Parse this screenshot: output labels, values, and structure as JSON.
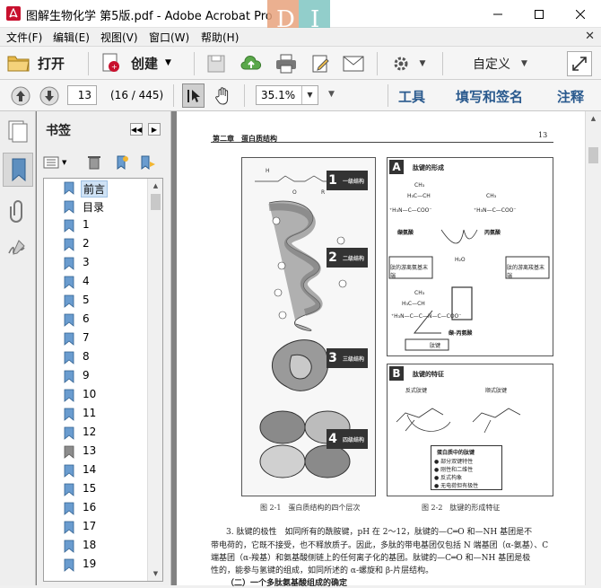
{
  "window": {
    "title": "图解生物化学 第5版.pdf - Adobe Acrobat Pro"
  },
  "menu": {
    "items": [
      "文件(F)",
      "编辑(E)",
      "视图(V)",
      "窗口(W)",
      "帮助(H)"
    ]
  },
  "toolbar": {
    "open_label": "打开",
    "create_label": "创建",
    "customize_label": "自定义"
  },
  "nav": {
    "page_value": "13",
    "page_count": "(16 / 445)",
    "zoom_value": "35.1%",
    "tools_label": "工具",
    "fill_sign_label": "填写和签名",
    "comment_label": "注释"
  },
  "bookmarks": {
    "title": "书签",
    "items": [
      "前言",
      "目录",
      "1",
      "2",
      "3",
      "4",
      "5",
      "6",
      "7",
      "8",
      "9",
      "10",
      "11",
      "12",
      "13",
      "14",
      "15",
      "16",
      "17",
      "18",
      "19"
    ],
    "selected": "前言"
  },
  "document": {
    "header_left": "第二章　蛋白质结构",
    "header_right": "13",
    "fig1_labels": [
      "一级结构",
      "二级结构",
      "三级结构",
      "四级结构"
    ],
    "fig1_numbers": [
      "1",
      "2",
      "3",
      "4"
    ],
    "fig1_caption": "图 2-1　蛋白质结构的四个层次",
    "fig2_caption": "图 2-2　肽键的形成特征",
    "panelA_title": "肽键的形成",
    "panelA_left": "缬氨酸",
    "panelA_right": "丙氨酸",
    "panelA_product": "缬-丙氨酸",
    "panelA_note_left": "肽的游离氨基末端",
    "panelA_note_right": "肽的游离羧基末端",
    "panelA_bond": "肽键",
    "panelB_title": "肽键的特征",
    "panelB_trans": "反式肽键",
    "panelB_cis": "顺式肽键",
    "panelB_list_title": "蛋白质中的肽键",
    "panelB_list": [
      "● 部分双键特性",
      "● 刚性和二维性",
      "● 反式构象",
      "● 无电荷但有极性"
    ],
    "para_lines": [
      "3. 肽键的极性　如同所有的酰胺键，pH 在 2～12，肽键的—C═O 和—NH 基团是不",
      "带电荷的，它既不接受，也不释放质子。因此，多肽的带电基团仅包括 N 端基团（α-氨基）、C",
      "端基团（α-羧基）和氨基酸侧链上的任何离子化的基团。肽键的—C═O 和—NH 基团是极",
      "性的，能参与氢键的组成，如同所述的 α-螺旋和 β-片层结构。"
    ],
    "subheading": "（二）一个多肽氨基酸组成的确定"
  }
}
